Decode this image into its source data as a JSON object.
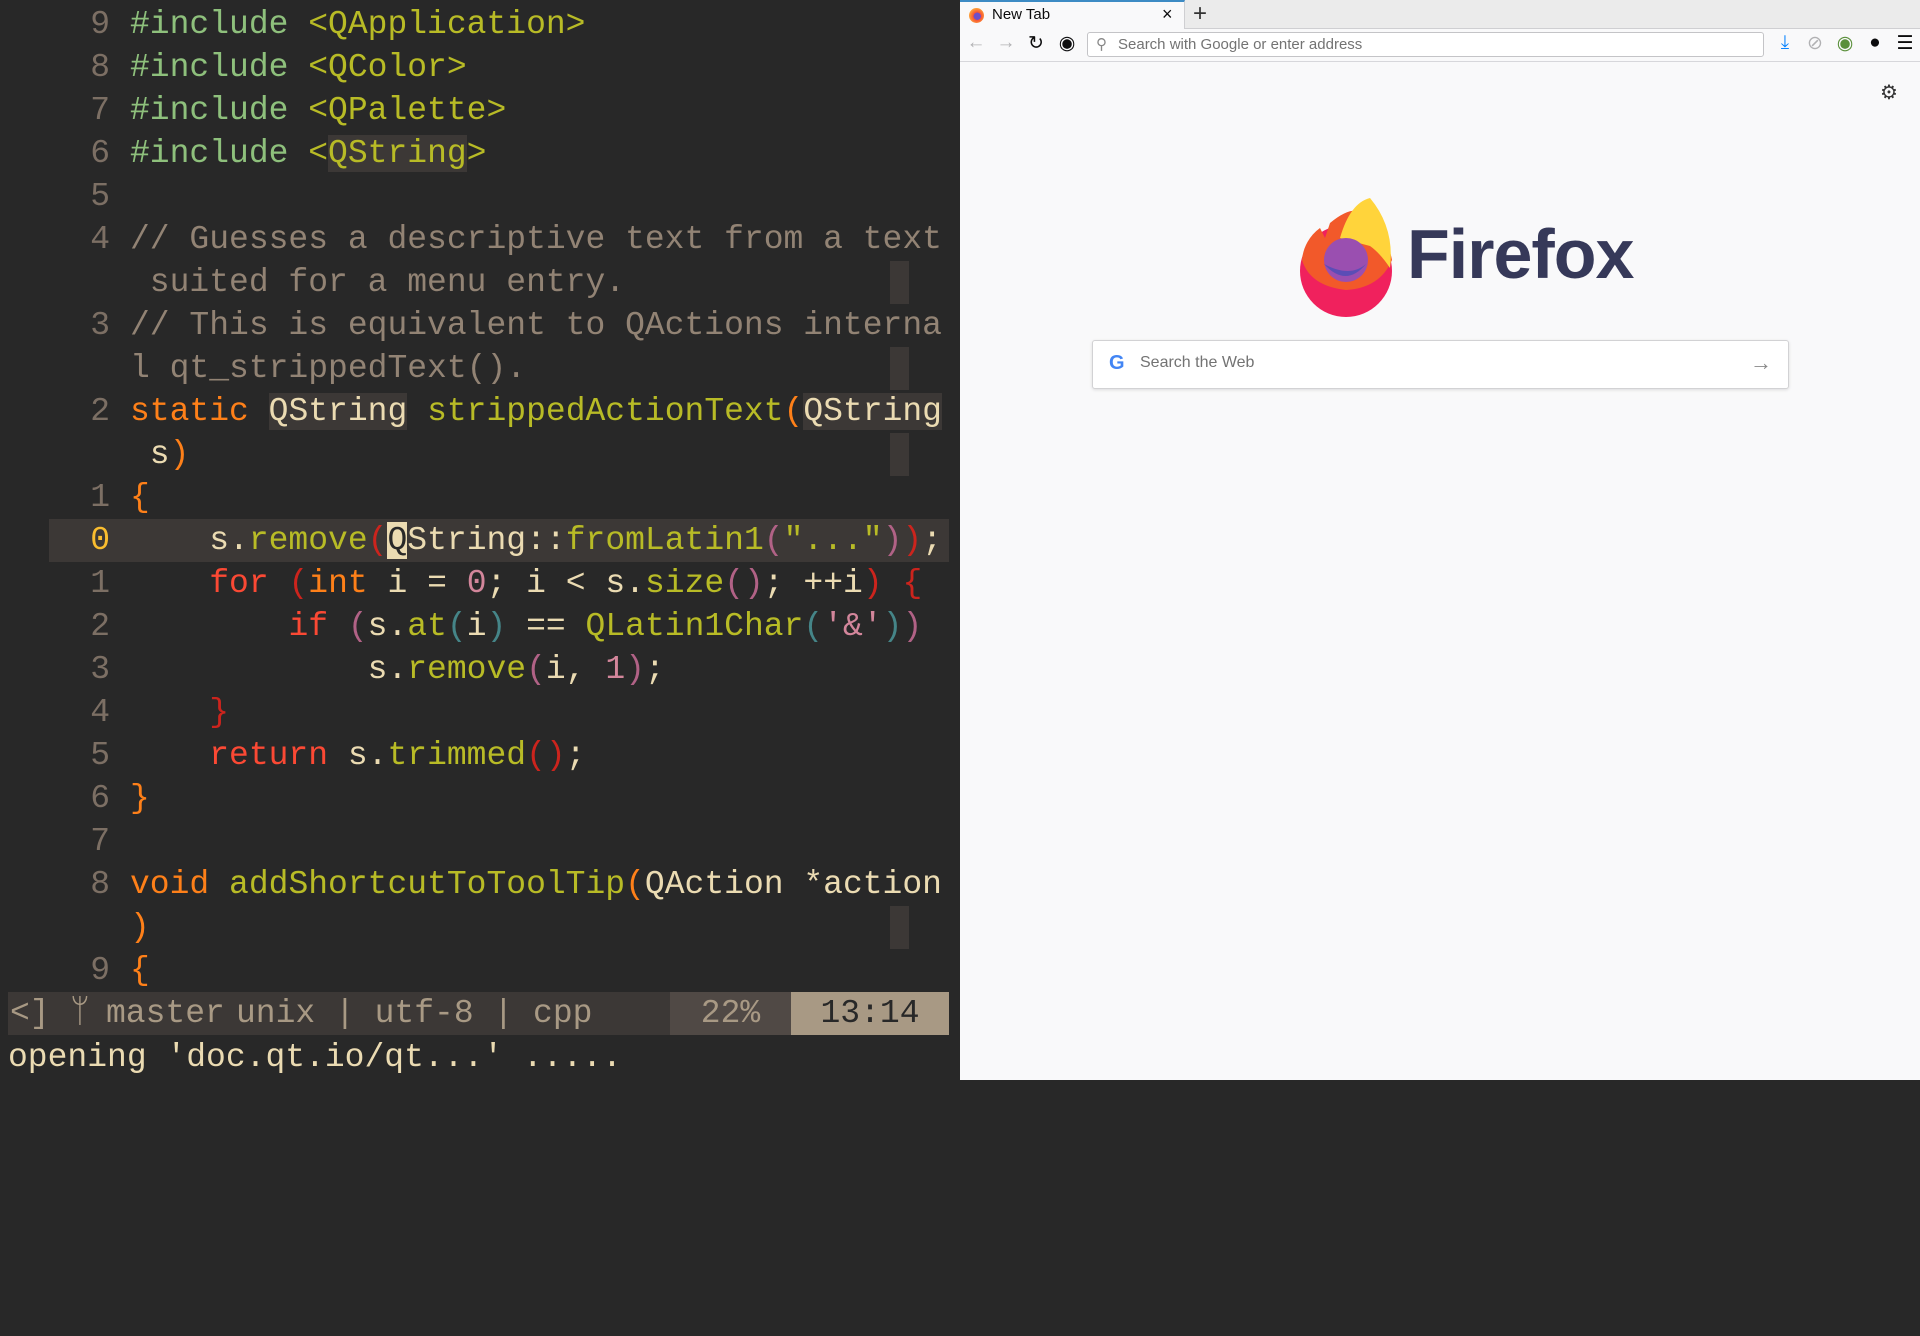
{
  "editor": {
    "rows": [
      {
        "num": "9",
        "tokens": [
          [
            "#include ",
            "inc"
          ],
          [
            "<QApplication>",
            "str"
          ]
        ]
      },
      {
        "num": "8",
        "tokens": [
          [
            "#include ",
            "inc"
          ],
          [
            "<QColor>",
            "str"
          ]
        ]
      },
      {
        "num": "7",
        "tokens": [
          [
            "#include ",
            "inc"
          ],
          [
            "<QPalette>",
            "str"
          ]
        ]
      },
      {
        "num": "6",
        "tokens": [
          [
            "#include ",
            "inc"
          ],
          [
            "<",
            "str"
          ],
          [
            "QString",
            "str hl"
          ],
          [
            ">",
            "str"
          ]
        ]
      },
      {
        "num": "5",
        "tokens": []
      },
      {
        "num": "4",
        "tokens": [
          [
            "// Guesses a descriptive text from a text",
            "cmt"
          ]
        ]
      },
      {
        "num": "",
        "wrap": true,
        "tokens": [
          [
            " suited for a menu entry.",
            "cmt"
          ]
        ]
      },
      {
        "num": "3",
        "tokens": [
          [
            "// This is equivalent to QActions interna",
            "cmt"
          ]
        ]
      },
      {
        "num": "",
        "wrap": true,
        "tokens": [
          [
            "l qt_strippedText().",
            "cmt"
          ]
        ]
      },
      {
        "num": "2",
        "tokens": [
          [
            "static",
            "kw"
          ],
          [
            " ",
            "fg"
          ],
          [
            "QString",
            "fg hl"
          ],
          [
            " ",
            "fg"
          ],
          [
            "strippedActionText",
            "fn"
          ],
          [
            "(",
            "po"
          ],
          [
            "QString",
            "fg hl"
          ]
        ]
      },
      {
        "num": "",
        "wrap": true,
        "tokens": [
          [
            " s",
            "fg"
          ],
          [
            ")",
            "po"
          ]
        ]
      },
      {
        "num": "1",
        "tokens": [
          [
            "{",
            "po"
          ]
        ]
      },
      {
        "num": "0",
        "current": true,
        "tokens": [
          [
            "    s.",
            "fg"
          ],
          [
            "remove",
            "fn"
          ],
          [
            "(",
            "pr"
          ],
          [
            "Q",
            "cursor"
          ],
          [
            "String::",
            "fg"
          ],
          [
            "fromLatin1",
            "fn"
          ],
          [
            "(",
            "pp"
          ],
          [
            "\"...\"",
            "str"
          ],
          [
            ")",
            "pp"
          ],
          [
            ")",
            "pr"
          ],
          [
            ";",
            "fg"
          ]
        ]
      },
      {
        "num": "1",
        "tokens": [
          [
            "    ",
            "fg"
          ],
          [
            "for",
            "kw2"
          ],
          [
            " ",
            "fg"
          ],
          [
            "(",
            "pr"
          ],
          [
            "int",
            "kw"
          ],
          [
            " i = ",
            "fg"
          ],
          [
            "0",
            "num"
          ],
          [
            "; i < s.",
            "fg"
          ],
          [
            "size",
            "fn"
          ],
          [
            "()",
            "pp"
          ],
          [
            "; ++i",
            "fg"
          ],
          [
            ")",
            "pr"
          ],
          [
            " ",
            "fg"
          ],
          [
            "{",
            "pr"
          ]
        ]
      },
      {
        "num": "2",
        "tokens": [
          [
            "        ",
            "fg"
          ],
          [
            "if",
            "kw2"
          ],
          [
            " ",
            "fg"
          ],
          [
            "(",
            "pp"
          ],
          [
            "s.",
            "fg"
          ],
          [
            "at",
            "fn"
          ],
          [
            "(",
            "pb"
          ],
          [
            "i",
            "fg"
          ],
          [
            ")",
            "pb"
          ],
          [
            " == ",
            "fg"
          ],
          [
            "QLatin1Char",
            "fn"
          ],
          [
            "(",
            "pb"
          ],
          [
            "'&'",
            "num"
          ],
          [
            ")",
            "pb"
          ],
          [
            ")",
            "pp"
          ]
        ]
      },
      {
        "num": "3",
        "tokens": [
          [
            "            s.",
            "fg"
          ],
          [
            "remove",
            "fn"
          ],
          [
            "(",
            "pp"
          ],
          [
            "i, ",
            "fg"
          ],
          [
            "1",
            "num"
          ],
          [
            ")",
            "pp"
          ],
          [
            ";",
            "fg"
          ]
        ]
      },
      {
        "num": "4",
        "tokens": [
          [
            "    ",
            "fg"
          ],
          [
            "}",
            "pr"
          ]
        ]
      },
      {
        "num": "5",
        "tokens": [
          [
            "    ",
            "fg"
          ],
          [
            "return",
            "kw2"
          ],
          [
            " s.",
            "fg"
          ],
          [
            "trimmed",
            "fn"
          ],
          [
            "()",
            "pr"
          ],
          [
            ";",
            "fg"
          ]
        ]
      },
      {
        "num": "6",
        "tokens": [
          [
            "}",
            "po"
          ]
        ]
      },
      {
        "num": "7",
        "tokens": []
      },
      {
        "num": "8",
        "tokens": [
          [
            "void",
            "kw"
          ],
          [
            " ",
            "fg"
          ],
          [
            "addShortcutToToolTip",
            "fn"
          ],
          [
            "(",
            "po"
          ],
          [
            "QAction *action",
            "fg"
          ]
        ]
      },
      {
        "num": "",
        "wrap": true,
        "tokens": [
          [
            ")",
            "po"
          ]
        ]
      },
      {
        "num": "9",
        "tokens": [
          [
            "{",
            "po"
          ]
        ]
      }
    ],
    "status": {
      "left": "<]",
      "branch_icon": "git-branch-icon",
      "branch": "master",
      "info": "unix | utf-8 | cpp",
      "percent": "22%",
      "position": "13:14"
    },
    "message": "opening 'doc.qt.io/qt...' ....."
  },
  "browser": {
    "tab_title": "New Tab",
    "tab_close": "×",
    "new_tab": "+",
    "address_placeholder": "Search with Google or enter address",
    "brand": "Firefox",
    "search_placeholder": "Search the Web",
    "google_g": "G",
    "accent": "#3d8bc4"
  }
}
